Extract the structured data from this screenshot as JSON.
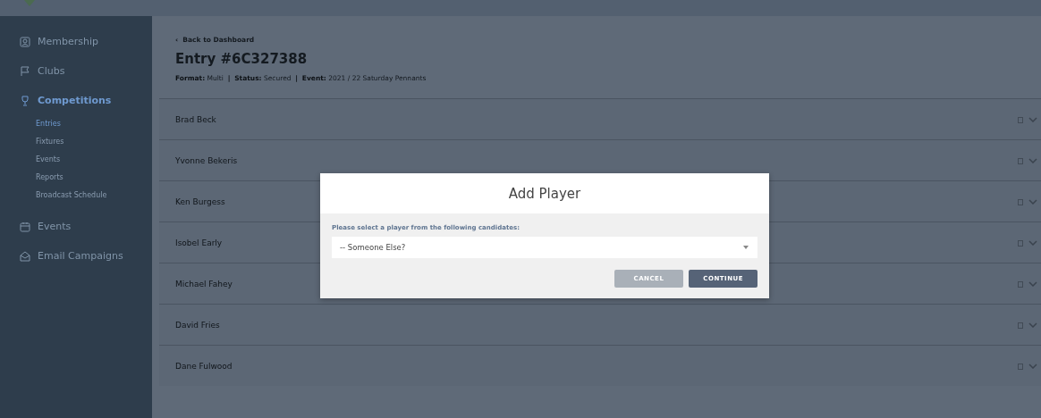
{
  "sidebar": {
    "items": [
      {
        "label": "Membership",
        "kind": "member",
        "selected": false
      },
      {
        "label": "Clubs",
        "kind": "flag",
        "selected": false
      },
      {
        "label": "Competitions",
        "kind": "trophy",
        "selected": true,
        "children": [
          {
            "label": "Entries",
            "selected": true
          },
          {
            "label": "Fixtures",
            "selected": false
          },
          {
            "label": "Events",
            "selected": false
          },
          {
            "label": "Reports",
            "selected": false
          },
          {
            "label": "Broadcast Schedule",
            "selected": false
          }
        ]
      },
      {
        "label": "Events",
        "kind": "calendar",
        "selected": false
      },
      {
        "label": "Email Campaigns",
        "kind": "mail",
        "selected": false
      }
    ]
  },
  "back_link": "‹  Back to Dashboard",
  "title": "Entry #6C327388",
  "meta": "**Format:** Multi  **|**  **Status:** Secured  **|**  **Event:** 2021 / 22 Saturday Pennants",
  "players": [
    "Brad Beck",
    "Yvonne Bekeris",
    "Ken Burgess",
    "Isobel Early",
    "Michael Fahey",
    "David Fries",
    "Dane Fulwood"
  ],
  "dialog": {
    "title": "Add Player",
    "prompt": "Please select a player from the following candidates:",
    "select_value": "-- Someone Else?",
    "buttons": [
      {
        "label": "CANCEL",
        "kind": "secondary"
      },
      {
        "label": "CONTINUE",
        "kind": "primary"
      }
    ]
  }
}
